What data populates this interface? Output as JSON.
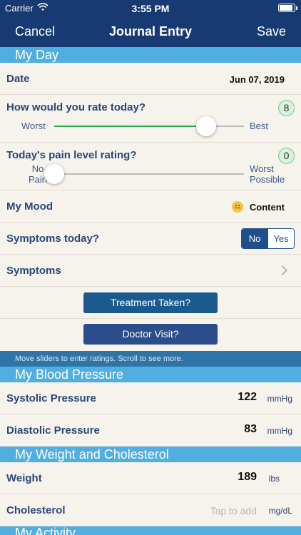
{
  "status_bar": {
    "carrier": "Carrier",
    "time": "3:55 PM"
  },
  "nav": {
    "cancel": "Cancel",
    "title": "Journal Entry",
    "save": "Save"
  },
  "sections": {
    "my_day": "My Day",
    "blood_pressure": "My Blood Pressure",
    "weight_cholesterol": "My Weight and Cholesterol",
    "activity": "My Activity"
  },
  "date": {
    "label": "Date",
    "value": "Jun 07, 2019"
  },
  "rating": {
    "label": "How would you rate today?",
    "value": "8",
    "low_label": "Worst",
    "high_label": "Best",
    "fraction": 0.8
  },
  "pain": {
    "label": "Today's pain level rating?",
    "value": "0",
    "low_label": "No\nPain",
    "high_label": "Worst\nPossible",
    "fraction": 0.0
  },
  "mood": {
    "label": "My Mood",
    "value": "Content"
  },
  "symptoms_today": {
    "label": "Symptoms today?",
    "options": [
      "No",
      "Yes"
    ],
    "selected": "No"
  },
  "symptoms": {
    "label": "Symptoms"
  },
  "buttons": {
    "treatment": "Treatment Taken?",
    "doctor": "Doctor Visit?"
  },
  "hint": "Move sliders to enter ratings. Scroll to see more.",
  "systolic": {
    "label": "Systolic Pressure",
    "value": "122",
    "unit": "mmHg"
  },
  "diastolic": {
    "label": "Diastolic Pressure",
    "value": "83",
    "unit": "mmHg"
  },
  "weight": {
    "label": "Weight",
    "value": "189",
    "unit": "lbs"
  },
  "cholesterol": {
    "label": "Cholesterol",
    "placeholder": "Tap to add",
    "unit": "mg/dL"
  },
  "colors": {
    "nav_bg": "#173a73",
    "section_bg": "#50aee0",
    "button_treatment": "#1a5a8e",
    "button_doctor": "#2c4d8c",
    "slider_fill": "#2aa84a",
    "badge_bg": "#d8f2dd"
  }
}
